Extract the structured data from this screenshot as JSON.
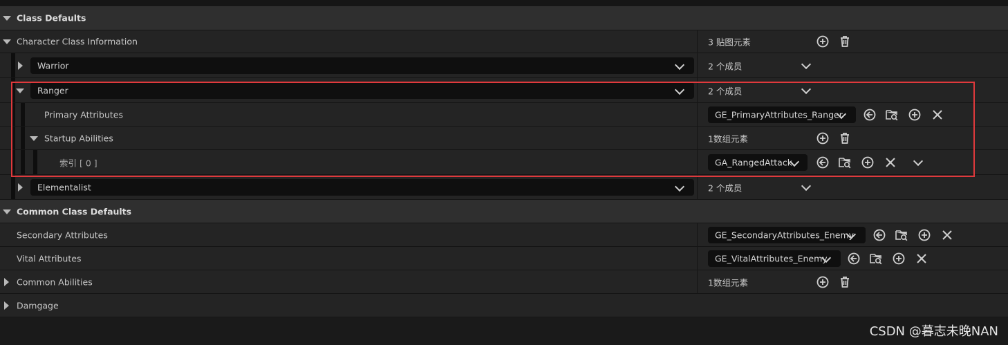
{
  "sections": {
    "class_defaults": "Class Defaults",
    "common_class_defaults": "Common Class Defaults"
  },
  "character_class_information": {
    "label": "Character Class Information",
    "value": "3 贴图元素"
  },
  "classes": {
    "warrior": {
      "name": "Warrior",
      "members": "2 个成员"
    },
    "ranger": {
      "name": "Ranger",
      "members": "2 个成员",
      "primary_attributes": {
        "label": "Primary Attributes",
        "value": "GE_PrimaryAttributes_Ranger"
      },
      "startup_abilities": {
        "label": "Startup Abilities",
        "value": "1数组元素"
      },
      "index0": {
        "label": "索引 [ 0 ]",
        "value": "GA_RangedAttack"
      }
    },
    "elementalist": {
      "name": "Elementalist",
      "members": "2 个成员"
    }
  },
  "common": {
    "secondary_attributes": {
      "label": "Secondary Attributes",
      "value": "GE_SecondaryAttributes_Enemy"
    },
    "vital_attributes": {
      "label": "Vital Attributes",
      "value": "GE_VitalAttributes_Enemy"
    },
    "common_abilities": {
      "label": "Common Abilities",
      "value": "1数组元素"
    },
    "damgage": {
      "label": "Damgage"
    }
  },
  "watermark": "CSDN @暮志未晚NAN",
  "colors": {
    "highlight_border": "#e0393c",
    "category_bg": "#2f2f2f",
    "row_bg": "#242424",
    "combo_bg": "#0f0f0f"
  }
}
